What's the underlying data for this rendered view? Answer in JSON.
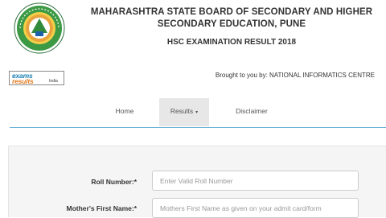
{
  "header": {
    "board_title": "MAHARASHTRA STATE BOARD OF SECONDARY AND HIGHER SECONDARY EDUCATION, PUNE",
    "exam_title": "HSC EXAMINATION RESULT 2018",
    "brought_by": "Brought to you by: NATIONAL INFORMATICS CENTRE"
  },
  "partner_logo": {
    "line1": "exams",
    "line2": "results",
    "line3": "India"
  },
  "nav": {
    "items": [
      {
        "label": "Home"
      },
      {
        "label": "Results",
        "caret": "▾"
      },
      {
        "label": "Disclaimer"
      }
    ],
    "active": "Results"
  },
  "form": {
    "roll_label": "Roll Number:*",
    "roll_placeholder": "Enter Valid Roll Number",
    "roll_value": "",
    "mother_label": "Mother's First Name:*",
    "mother_placeholder": "Mothers First Name as given on your admit card/form",
    "mother_value": ""
  },
  "colors": {
    "nav_underline": "#6fb3d8",
    "active_tab_bg": "#e7e7e7",
    "panel_bg": "#f5f5f5",
    "logo_green": "#2f8a3b",
    "logo_orange": "#e8a33d"
  },
  "icons": {
    "board_logo": "maharashtra-board-seal-icon",
    "dropdown": "caret-down-icon"
  }
}
